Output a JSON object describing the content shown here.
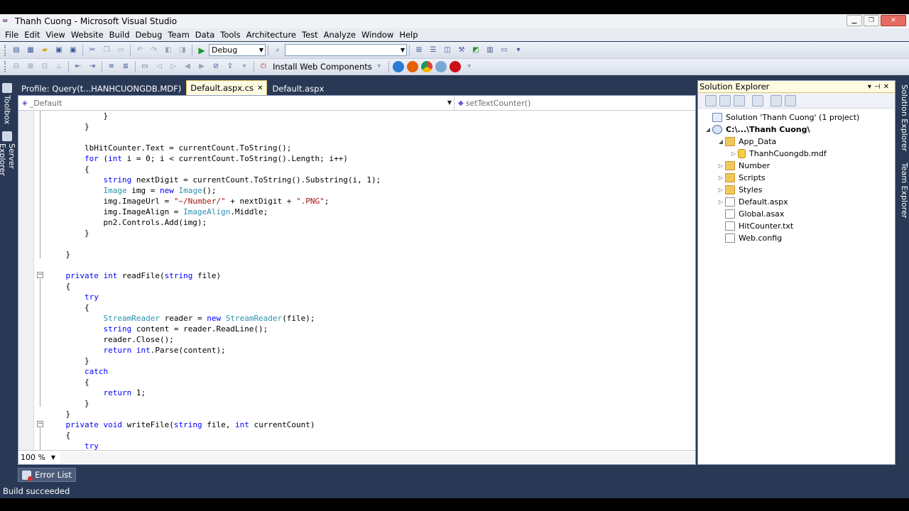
{
  "window": {
    "title": "Thanh Cuong - Microsoft Visual Studio",
    "logo": "vs-logo",
    "controls": [
      "minimize",
      "restore",
      "close"
    ]
  },
  "menu": [
    "File",
    "Edit",
    "View",
    "Website",
    "Build",
    "Debug",
    "Team",
    "Data",
    "Tools",
    "Architecture",
    "Test",
    "Analyze",
    "Window",
    "Help"
  ],
  "toolbar": {
    "config_value": "Debug",
    "find_value": "",
    "install_label": "Install Web Components"
  },
  "tabs": [
    {
      "label": "Profile: Query(t...HANHCUONGDB.MDF)",
      "active": false
    },
    {
      "label": "Default.aspx.cs",
      "active": true
    },
    {
      "label": "Default.aspx",
      "active": false
    }
  ],
  "left_tabs": [
    "Toolbox",
    "Server Explorer"
  ],
  "right_tabs": [
    "Solution Explorer",
    "Team Explorer"
  ],
  "editor": {
    "type_dropdown": "_Default",
    "member_dropdown": "setTextCounter()",
    "zoom": "100 %",
    "code_lines": [
      [
        {
          "t": "            }"
        }
      ],
      [
        {
          "t": "        }"
        }
      ],
      [
        {
          "t": ""
        }
      ],
      [
        {
          "t": "        lbHitCounter.Text = currentCount.ToString();"
        }
      ],
      [
        {
          "t": "        ",
          "c": ""
        },
        {
          "t": "for",
          "c": "kw"
        },
        {
          "t": " ("
        },
        {
          "t": "int",
          "c": "kw"
        },
        {
          "t": " i = 0; i < currentCount.ToString().Length; i++)"
        }
      ],
      [
        {
          "t": "        {"
        }
      ],
      [
        {
          "t": "            "
        },
        {
          "t": "string",
          "c": "kw"
        },
        {
          "t": " nextDigit = currentCount.ToString().Substring(i, 1);"
        }
      ],
      [
        {
          "t": "            "
        },
        {
          "t": "Image",
          "c": "ty"
        },
        {
          "t": " img = "
        },
        {
          "t": "new",
          "c": "kw"
        },
        {
          "t": " "
        },
        {
          "t": "Image",
          "c": "ty"
        },
        {
          "t": "();"
        }
      ],
      [
        {
          "t": "            img.ImageUrl = "
        },
        {
          "t": "\"~/Number/\"",
          "c": "st"
        },
        {
          "t": " + nextDigit + "
        },
        {
          "t": "\".PNG\"",
          "c": "st"
        },
        {
          "t": ";"
        }
      ],
      [
        {
          "t": "            img.ImageAlign = "
        },
        {
          "t": "ImageAlign",
          "c": "ty"
        },
        {
          "t": ".Middle;"
        }
      ],
      [
        {
          "t": "            pn2.Controls.Add(img);"
        }
      ],
      [
        {
          "t": "        }"
        }
      ],
      [
        {
          "t": ""
        }
      ],
      [
        {
          "t": "    }"
        }
      ],
      [
        {
          "t": ""
        }
      ],
      [
        {
          "t": "    "
        },
        {
          "t": "private",
          "c": "kw"
        },
        {
          "t": " "
        },
        {
          "t": "int",
          "c": "kw"
        },
        {
          "t": " readFile("
        },
        {
          "t": "string",
          "c": "kw"
        },
        {
          "t": " file)"
        }
      ],
      [
        {
          "t": "    {"
        }
      ],
      [
        {
          "t": "        "
        },
        {
          "t": "try",
          "c": "kw"
        }
      ],
      [
        {
          "t": "        {"
        }
      ],
      [
        {
          "t": "            "
        },
        {
          "t": "StreamReader",
          "c": "ty"
        },
        {
          "t": " reader = "
        },
        {
          "t": "new",
          "c": "kw"
        },
        {
          "t": " "
        },
        {
          "t": "StreamReader",
          "c": "ty"
        },
        {
          "t": "(file);"
        }
      ],
      [
        {
          "t": "            "
        },
        {
          "t": "string",
          "c": "kw"
        },
        {
          "t": " content = reader.ReadLine();"
        }
      ],
      [
        {
          "t": "            reader.Close();"
        }
      ],
      [
        {
          "t": "            "
        },
        {
          "t": "return",
          "c": "kw"
        },
        {
          "t": " "
        },
        {
          "t": "int",
          "c": "kw"
        },
        {
          "t": ".Parse(content);"
        }
      ],
      [
        {
          "t": "        }"
        }
      ],
      [
        {
          "t": "        "
        },
        {
          "t": "catch",
          "c": "kw"
        }
      ],
      [
        {
          "t": "        {"
        }
      ],
      [
        {
          "t": "            "
        },
        {
          "t": "return",
          "c": "kw"
        },
        {
          "t": " 1;"
        }
      ],
      [
        {
          "t": "        }"
        }
      ],
      [
        {
          "t": "    }"
        }
      ],
      [
        {
          "t": "    "
        },
        {
          "t": "private",
          "c": "kw"
        },
        {
          "t": " "
        },
        {
          "t": "void",
          "c": "kw"
        },
        {
          "t": " writeFile("
        },
        {
          "t": "string",
          "c": "kw"
        },
        {
          "t": " file, "
        },
        {
          "t": "int",
          "c": "kw"
        },
        {
          "t": " currentCount)"
        }
      ],
      [
        {
          "t": "    {"
        }
      ],
      [
        {
          "t": "        "
        },
        {
          "t": "try",
          "c": "kw"
        }
      ]
    ]
  },
  "solution_explorer": {
    "title": "Solution Explorer",
    "items": [
      {
        "label": "Solution 'Thanh Cuong' (1 project)",
        "icon": "sol",
        "level": 0,
        "exp": ""
      },
      {
        "label": "C:\\...\\Thanh Cuong\\",
        "icon": "proj",
        "level": 0,
        "exp": "expanded",
        "bold": true
      },
      {
        "label": "App_Data",
        "icon": "folder",
        "level": 1,
        "exp": "expanded"
      },
      {
        "label": "ThanhCuongdb.mdf",
        "icon": "db",
        "level": 2,
        "exp": "collapsed"
      },
      {
        "label": "Number",
        "icon": "folder",
        "level": 1,
        "exp": "collapsed"
      },
      {
        "label": "Scripts",
        "icon": "folder",
        "level": 1,
        "exp": "collapsed"
      },
      {
        "label": "Styles",
        "icon": "folder",
        "level": 1,
        "exp": "collapsed"
      },
      {
        "label": "Default.aspx",
        "icon": "page",
        "level": 1,
        "exp": "collapsed"
      },
      {
        "label": "Global.asax",
        "icon": "page",
        "level": 1,
        "exp": ""
      },
      {
        "label": "HitCounter.txt",
        "icon": "page",
        "level": 1,
        "exp": ""
      },
      {
        "label": "Web.config",
        "icon": "page",
        "level": 1,
        "exp": ""
      }
    ]
  },
  "bottom": {
    "error_list": "Error List",
    "status": "Build succeeded"
  }
}
